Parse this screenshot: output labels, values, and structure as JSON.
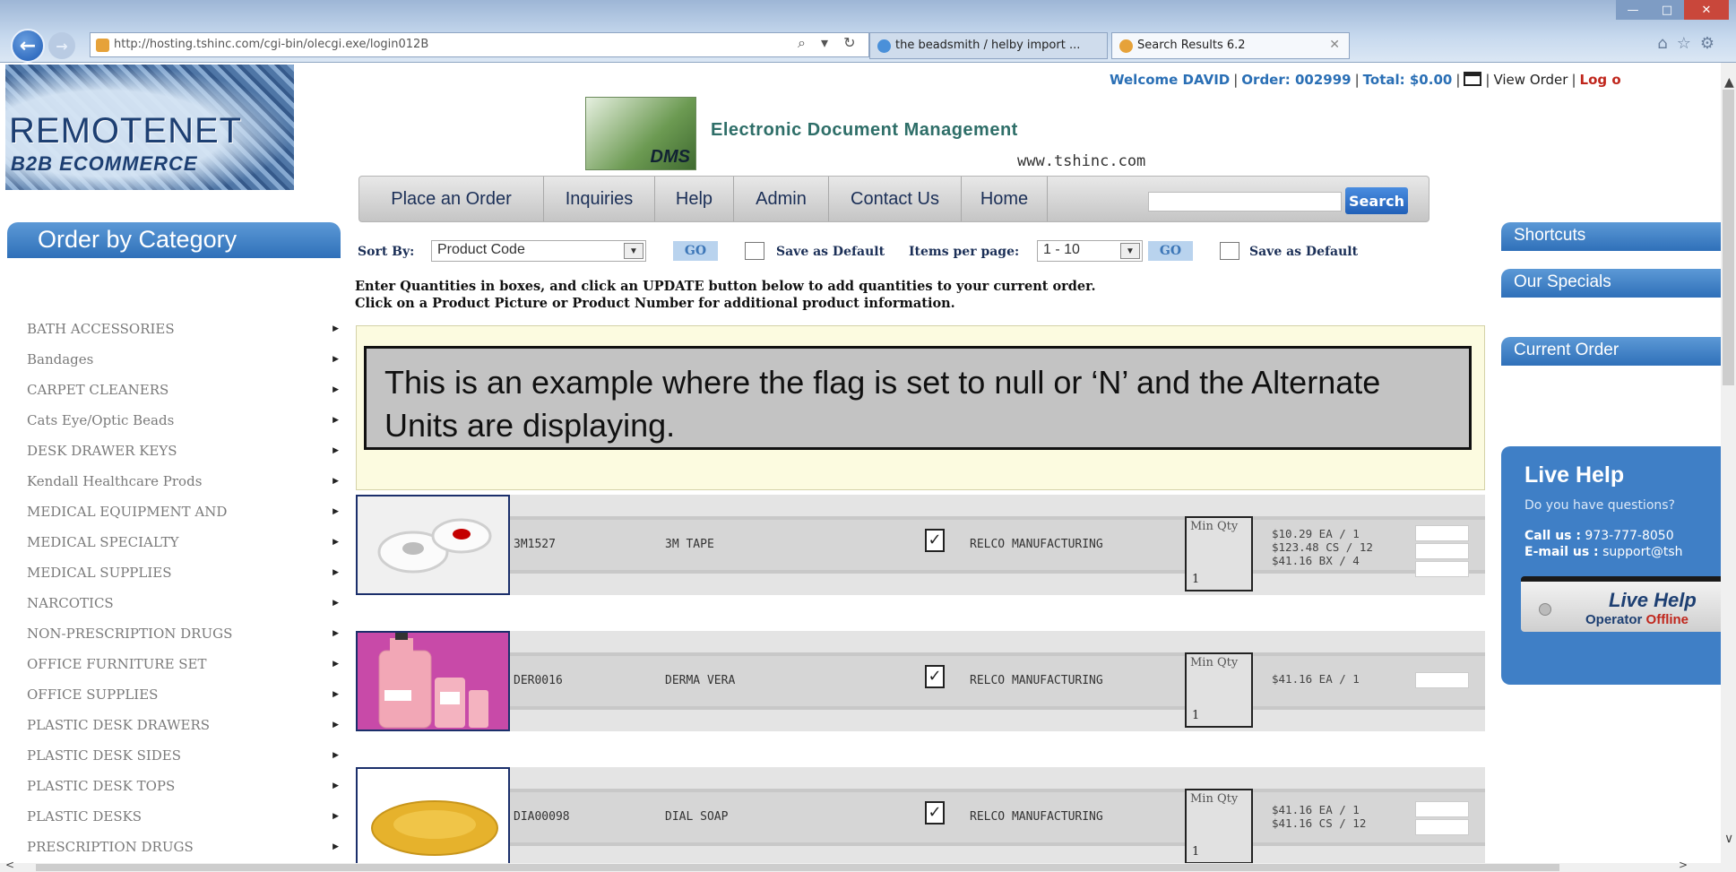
{
  "browser": {
    "address": "http://hosting.tshinc.com/cgi-bin/olecgi.exe/login012B",
    "address_actions": "⌕ ▾ ↻",
    "tabs": [
      {
        "label": "the beadsmith / helby import ..."
      },
      {
        "label": "Search Results 6.2"
      }
    ],
    "window_controls": {
      "minimize": "—",
      "maximize": "□",
      "close": "✕"
    },
    "toolbar_icons": "⌂☆⚙"
  },
  "logo": {
    "title": "REMOTENET",
    "subtitle": "B2B ECOMMERCE"
  },
  "dms": {
    "logo_text": "DMS",
    "title": "Electronic Document Management",
    "url": "www.tshinc.com"
  },
  "welcome": {
    "greeting": "Welcome DAVID",
    "order": "Order: 002999",
    "total": "Total: $0.00",
    "view_order": "View Order",
    "logout": "Log o"
  },
  "nav": {
    "items": [
      "Place an Order",
      "Inquiries",
      "Help",
      "Admin",
      "Contact Us",
      "Home"
    ],
    "search_label": "Search",
    "search_value": ""
  },
  "sidebar": {
    "header": "Order by Category",
    "categories": [
      "BATH ACCESSORIES",
      "Bandages",
      "CARPET CLEANERS",
      "Cats Eye/Optic Beads",
      "DESK DRAWER KEYS",
      "Kendall Healthcare Prods",
      "MEDICAL EQUIPMENT AND",
      "MEDICAL SPECIALTY",
      "MEDICAL SUPPLIES",
      "NARCOTICS",
      "NON-PRESCRIPTION DRUGS",
      "OFFICE FURNITURE SET",
      "OFFICE SUPPLIES",
      "PLASTIC DESK DRAWERS",
      "PLASTIC DESK SIDES",
      "PLASTIC DESK TOPS",
      "PLASTIC DESKS",
      "PRESCRIPTION DRUGS"
    ]
  },
  "sort_bar": {
    "sort_by_label": "Sort By:",
    "sort_by_value": "Product Code",
    "go_label": "GO",
    "save_default_label": "Save as Default",
    "items_per_page_label": "Items per page:",
    "items_per_page_value": "1 - 10"
  },
  "instructions": {
    "line1": "Enter Quantities in boxes, and click an UPDATE button below to add quantities to your current order.",
    "line2": "Click on a Product Picture or Product Number for additional product information."
  },
  "callout": {
    "text": "This is an example where the flag is set to null or ‘N’ and the Alternate Units are displaying."
  },
  "products": [
    {
      "code": "3M1527",
      "name": "3M TAPE",
      "checked": "✓",
      "manufacturer": "RELCO MANUFACTURING",
      "min_qty_label": "Min Qty",
      "min_qty": "1",
      "prices": [
        "$10.29 EA / 1",
        "$123.48 CS / 12",
        "$41.16 BX / 4"
      ],
      "image": "tape-rolls"
    },
    {
      "code": "DER0016",
      "name": "DERMA VERA",
      "checked": "✓",
      "manufacturer": "RELCO MANUFACTURING",
      "min_qty_label": "Min Qty",
      "min_qty": "1",
      "prices": [
        "$41.16 EA / 1"
      ],
      "image": "lotion-bottles"
    },
    {
      "code": "DIA00098",
      "name": "DIAL SOAP",
      "checked": "✓",
      "manufacturer": "RELCO MANUFACTURING",
      "min_qty_label": "Min Qty",
      "min_qty": "1",
      "prices": [
        "$41.16 EA / 1",
        "$41.16 CS / 12"
      ],
      "image": "soap-bar"
    }
  ],
  "right_sidebar": {
    "shortcuts": "Shortcuts",
    "specials": "Our Specials",
    "current_order": "Current Order",
    "live_help": {
      "title": "Live Help",
      "question": "Do you have questions?",
      "call_label": "Call us :",
      "call_value": "973-777-8050",
      "email_label": "E-mail us :",
      "email_value": "support@tsh",
      "button_title": "Live Help",
      "status_label": "Operator",
      "status_value": "Offline"
    }
  },
  "scroll_arrows": {
    "up": "▲",
    "down": "∨",
    "left": "<",
    "right": ">"
  },
  "colors": {
    "accent_blue": "#2f70b9",
    "offline_red": "#c0271d",
    "callout_bg": "#c3c3c3",
    "yellow_box": "#fcfbe0"
  }
}
